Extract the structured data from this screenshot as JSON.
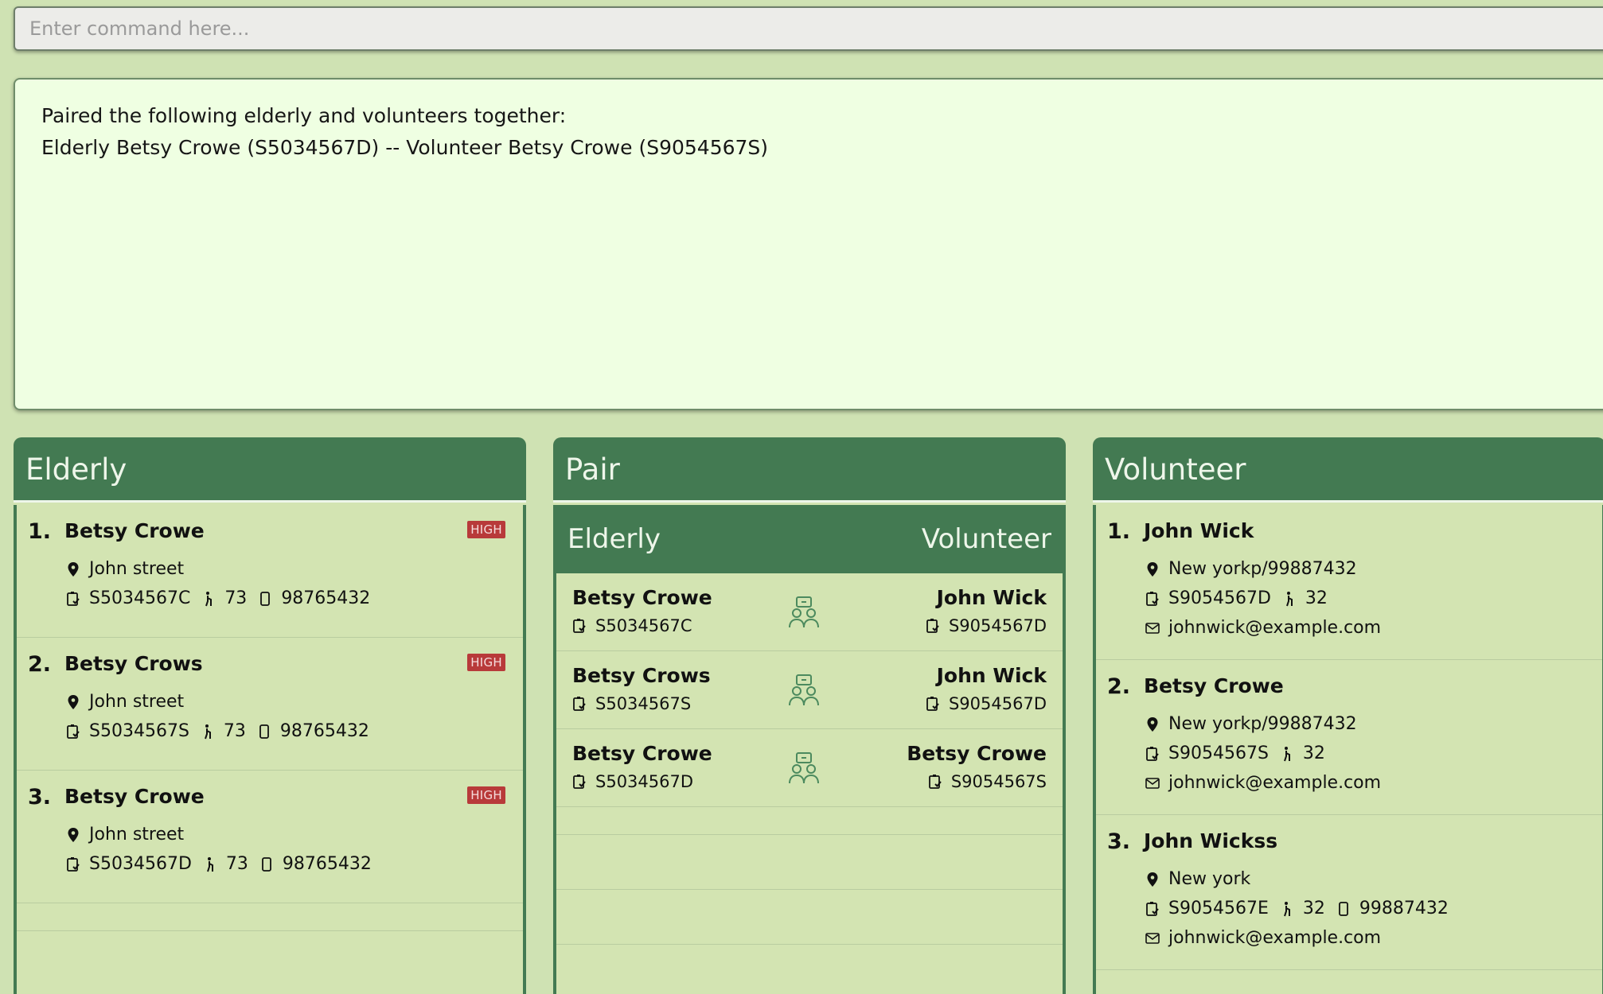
{
  "command": {
    "placeholder": "Enter command here...",
    "value": ""
  },
  "result": {
    "line1": "Paired the following elderly and volunteers together:",
    "line2": "Elderly Betsy Crowe (S5034567D) -- Volunteer Betsy Crowe (S9054567S)"
  },
  "elderly": {
    "title": "Elderly",
    "items": [
      {
        "num": "1.",
        "name": "Betsy Crowe",
        "risk": "HIGH",
        "address": "John street",
        "nric": "S5034567C",
        "age": "73",
        "phone": "98765432"
      },
      {
        "num": "2.",
        "name": "Betsy Crows",
        "risk": "HIGH",
        "address": "John street",
        "nric": "S5034567S",
        "age": "73",
        "phone": "98765432"
      },
      {
        "num": "3.",
        "name": "Betsy Crowe",
        "risk": "HIGH",
        "address": "John street",
        "nric": "S5034567D",
        "age": "73",
        "phone": "98765432"
      }
    ]
  },
  "pair": {
    "title": "Pair",
    "col_left": "Elderly",
    "col_right": "Volunteer",
    "items": [
      {
        "elderly_name": "Betsy Crowe",
        "elderly_nric": "S5034567C",
        "volunteer_name": "John Wick",
        "volunteer_nric": "S9054567D"
      },
      {
        "elderly_name": "Betsy Crows",
        "elderly_nric": "S5034567S",
        "volunteer_name": "John Wick",
        "volunteer_nric": "S9054567D"
      },
      {
        "elderly_name": "Betsy Crowe",
        "elderly_nric": "S5034567D",
        "volunteer_name": "Betsy Crowe",
        "volunteer_nric": "S9054567S"
      }
    ]
  },
  "volunteer": {
    "title": "Volunteer",
    "items": [
      {
        "num": "1.",
        "name": "John Wick",
        "address": "New yorkp/99887432",
        "nric": "S9054567D",
        "age": "32",
        "email": "johnwick@example.com"
      },
      {
        "num": "2.",
        "name": "Betsy Crowe",
        "address": "New yorkp/99887432",
        "nric": "S9054567S",
        "age": "32",
        "email": "johnwick@example.com"
      },
      {
        "num": "3.",
        "name": "John Wickss",
        "address": "New york",
        "nric": "S9054567E",
        "age": "32",
        "phone": "99887432",
        "email": "johnwick@example.com"
      }
    ]
  },
  "colors": {
    "header": "#437a52",
    "background": "#cfe2b3",
    "result_bg": "#efffe2",
    "badge_high": "#b83a3a"
  }
}
